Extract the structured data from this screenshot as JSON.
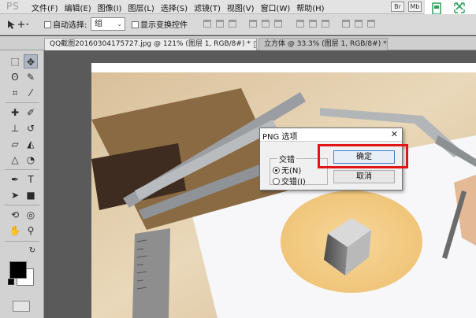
{
  "app": {
    "logo": "PS"
  },
  "menu": [
    "文件(F)",
    "编辑(E)",
    "图像(I)",
    "图层(L)",
    "选择(S)",
    "滤镜(T)",
    "视图(V)",
    "窗口(W)",
    "帮助(H)"
  ],
  "menubar_icons": [
    "Br",
    "Mb"
  ],
  "options": {
    "auto_select_label": "自动选择:",
    "auto_select_value": "组",
    "show_transform_label": "显示变换控件"
  },
  "tabs": [
    {
      "label": "QQ截图20160304175727.jpg @ 121% (图层 1, RGB/8#) *",
      "active": true
    },
    {
      "label": "立方体 @ 33.3% (图层 1, RGB/8#) *",
      "active": false
    }
  ],
  "dialog": {
    "title": "PNG 选项",
    "group_label": "交错",
    "options": [
      {
        "label": "无(N)",
        "selected": true
      },
      {
        "label": "交错(I)",
        "selected": false
      }
    ],
    "ok_label": "确定",
    "cancel_label": "取消"
  },
  "colors": {
    "highlight": "#e01515",
    "foreground": "#000000",
    "background": "#ffffff"
  }
}
